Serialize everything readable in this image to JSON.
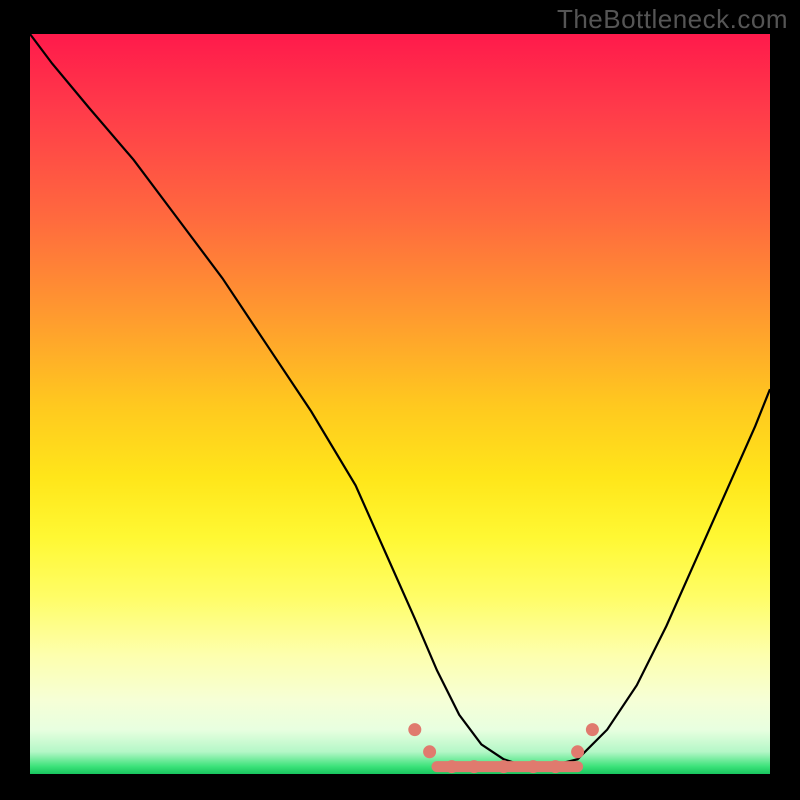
{
  "watermark": "TheBottleneck.com",
  "colors": {
    "page_bg": "#000000",
    "watermark": "#555555",
    "curve": "#000000",
    "marker": "#e07a6e",
    "gradient_top": "#ff1a4b",
    "gradient_bottom": "#18c55e"
  },
  "chart_data": {
    "type": "line",
    "title": "",
    "xlabel": "",
    "ylabel": "",
    "xlim": [
      0,
      100
    ],
    "ylim": [
      0,
      100
    ],
    "grid": false,
    "legend": false,
    "series": [
      {
        "name": "bottleneck-curve",
        "x": [
          0,
          3,
          8,
          14,
          20,
          26,
          32,
          38,
          44,
          48,
          52,
          55,
          58,
          61,
          64,
          67,
          70,
          74,
          78,
          82,
          86,
          90,
          94,
          98,
          100
        ],
        "y": [
          100,
          96,
          90,
          83,
          75,
          67,
          58,
          49,
          39,
          30,
          21,
          14,
          8,
          4,
          2,
          1,
          1,
          2,
          6,
          12,
          20,
          29,
          38,
          47,
          52
        ]
      }
    ],
    "flat_region": {
      "x_start": 55,
      "x_end": 74,
      "y": 1
    },
    "markers": [
      {
        "x": 52,
        "y": 6
      },
      {
        "x": 54,
        "y": 3
      },
      {
        "x": 57,
        "y": 1
      },
      {
        "x": 60,
        "y": 1
      },
      {
        "x": 64,
        "y": 1
      },
      {
        "x": 68,
        "y": 1
      },
      {
        "x": 71,
        "y": 1
      },
      {
        "x": 74,
        "y": 3
      },
      {
        "x": 76,
        "y": 6
      }
    ]
  }
}
